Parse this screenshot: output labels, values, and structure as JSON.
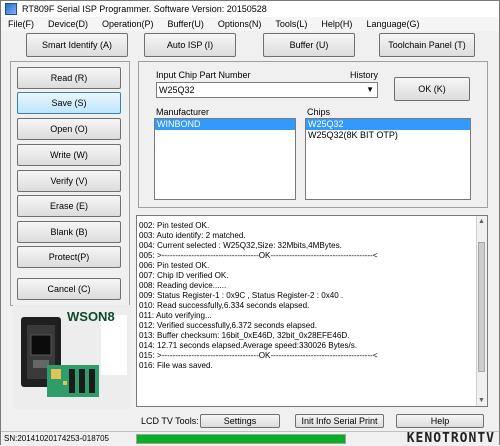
{
  "window": {
    "title": "RT809F Serial ISP Programmer. Software Version: 20150528"
  },
  "menu": [
    "File(F)",
    "Device(D)",
    "Operation(P)",
    "Buffer(U)",
    "Options(N)",
    "Tools(L)",
    "Help(H)",
    "Language(G)"
  ],
  "toolbar": {
    "smart_identify": "Smart Identify (A)",
    "auto_isp": "Auto ISP (I)",
    "buffer": "Buffer (U)",
    "toolchain_panel": "Toolchain Panel (T)"
  },
  "left_buttons": [
    "Read (R)",
    "Save (S)",
    "Open (O)",
    "Write  (W)",
    "Verify (V)",
    "Erase (E)",
    "Blank (B)",
    "Protect(P)"
  ],
  "cancel": "Cancel (C)",
  "chip": {
    "input_label": "Input Chip Part Number",
    "history_label": "History",
    "part_number": "W25Q32",
    "ok": "OK (K)",
    "manufacturer_label": "Manufacturer",
    "chips_label": "Chips",
    "manufacturers": [
      "WINBOND"
    ],
    "chips": [
      "W25Q32",
      "W25Q32(8K BIT OTP)"
    ]
  },
  "log": [
    "002:  Pin tested OK.",
    "003:  Auto identify: 2 matched.",
    "004:  Current selected : W25Q32,Size: 32Mbits,4MBytes.",
    "005:  >------------------------------------OK--------------------------------------<",
    "006:  Pin tested OK.",
    "007:  Chip ID verified OK.",
    "008:  Reading device......",
    "009:  Status Register-1 : 0x9C , Status Register-2 : 0x40 .",
    "010:  Read successfully,6.334 seconds elapsed.",
    "011:  Auto verifying...",
    "012:  Verified successfully,6.372 seconds elapsed.",
    "013:  Buffer checksum: 16bit_0xE46D, 32bit_0x28EFE46D.",
    "014:  12.71 seconds elapsed.Average speed:330026 Bytes/s.",
    "015:  >------------------------------------OK--------------------------------------<",
    "016:  File was saved."
  ],
  "image_label": "WSON8",
  "lcd": {
    "label": "LCD TV Tools:",
    "settings": "Settings",
    "init_info": "Init Info Serial Print",
    "help": "Help"
  },
  "status": {
    "sn": "SN:20141020174253-018705",
    "progress": 1.0,
    "watermark": "KENOTRONTV"
  },
  "colors": {
    "selection": "#3399ff",
    "progress": "#06b025",
    "pcb": "#2e9d6a"
  }
}
